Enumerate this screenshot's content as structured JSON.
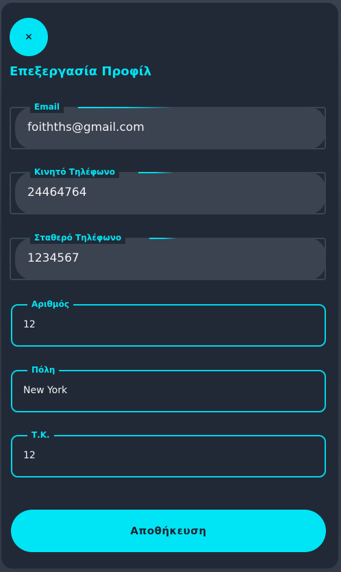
{
  "dialog": {
    "close_label": "×",
    "title": "Επεξεργασία Προφίλ",
    "save_label": "Αποθήκευση"
  },
  "fields": {
    "email": {
      "label": "Email",
      "value": "foithths@gmail.com"
    },
    "mobile": {
      "label": "Κινητό Τηλέφωνο",
      "value": "24464764"
    },
    "landline": {
      "label": "Σταθερό Τηλέφωνο",
      "value": "1234567"
    },
    "number": {
      "label": "Αριθμός",
      "value": "12"
    },
    "city": {
      "label": "Πόλη",
      "value": "New York"
    },
    "postal": {
      "label": "Τ.Κ.",
      "value": "12"
    }
  },
  "colors": {
    "accent": "#00e5f5",
    "panel": "#222936",
    "field_fill": "#3b4250",
    "text": "#f2f2f2"
  },
  "icons": {
    "close": "close-icon"
  }
}
